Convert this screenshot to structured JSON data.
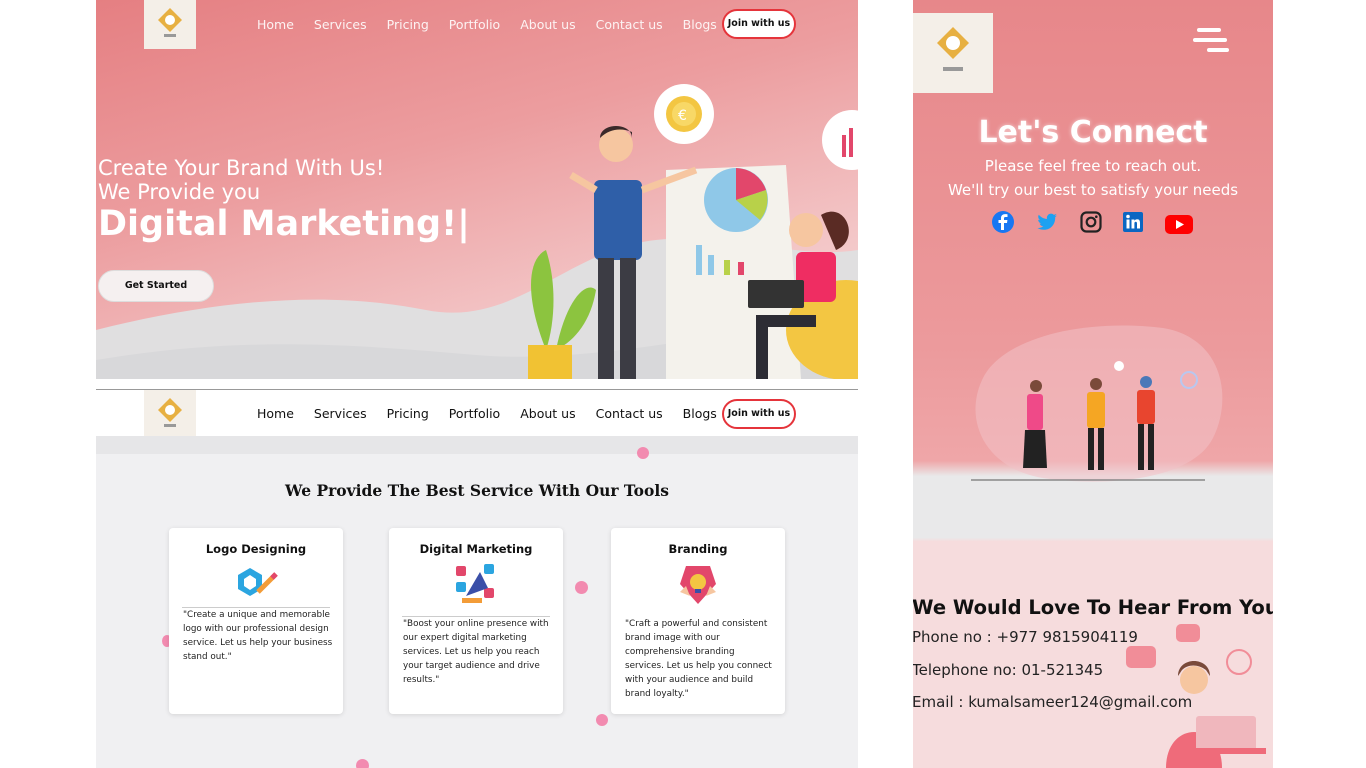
{
  "nav": {
    "items": [
      "Home",
      "Services",
      "Pricing",
      "Portfolio",
      "About us",
      "Contact us",
      "Blogs"
    ],
    "join_label": "Join with us"
  },
  "hero": {
    "line1": "Create Your Brand With Us!",
    "line2": "We Provide you",
    "line3": "Digital Marketing!|",
    "cta": "Get Started"
  },
  "services": {
    "title": "We Provide The Best Service With Our Tools",
    "cards": [
      {
        "title": "Logo Designing",
        "text": "\"Create a unique and memorable logo with our professional design service. Let us help your business stand out.\""
      },
      {
        "title": "Digital Marketing",
        "text": "\"Boost your online presence with our expert digital marketing services. Let us help you reach your target audience and drive results.\""
      },
      {
        "title": "Branding",
        "text": "\"Craft a powerful and consistent brand image with our comprehensive branding services. Let us help you connect with your audience and build brand loyalty.\""
      }
    ]
  },
  "connect": {
    "title": "Let's Connect",
    "sub1": "Please feel free to reach out.",
    "sub2": "We'll try our best to satisfy your needs",
    "social": [
      "facebook-icon",
      "twitter-icon",
      "instagram-icon",
      "linkedin-icon",
      "youtube-icon"
    ]
  },
  "contact": {
    "title": "We Would Love To Hear From You",
    "phone": "Phone no : +977 9815904119",
    "telephone": "Telephone no: 01-521345",
    "email": "Email : kumalsameer124@gmail.com"
  },
  "colors": {
    "accent": "#e5343b",
    "hero_pink": "#e57f82",
    "dot_pink": "#f28bb0"
  }
}
